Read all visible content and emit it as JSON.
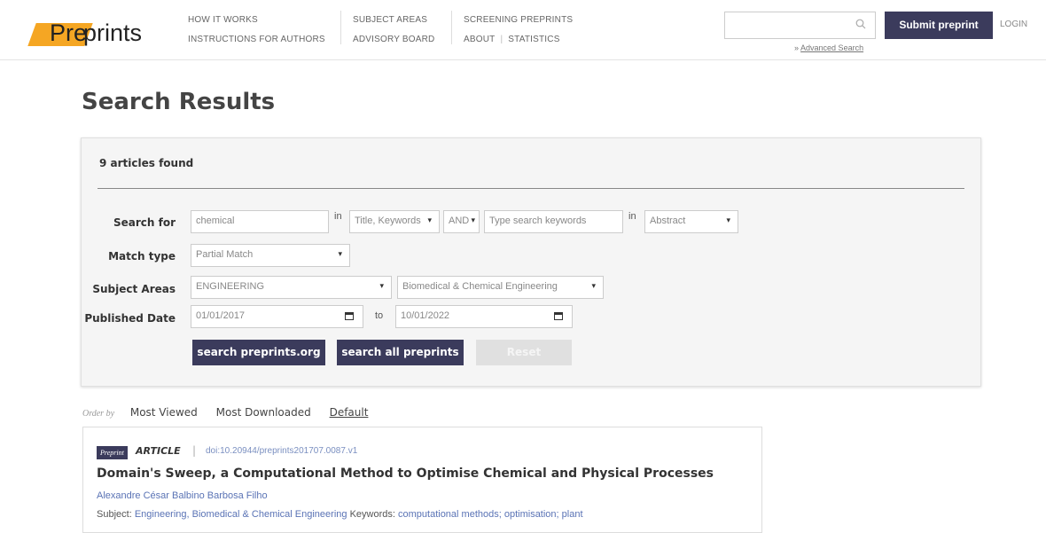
{
  "header": {
    "logo_pre": "Pre",
    "logo_prints": "prints",
    "nav": {
      "how_it_works": "HOW IT WORKS",
      "instructions": "INSTRUCTIONS FOR AUTHORS",
      "subject_areas": "SUBJECT AREAS",
      "advisory_board": "ADVISORY BOARD",
      "screening": "SCREENING PREPRINTS",
      "about": "ABOUT",
      "statistics": "STATISTICS"
    },
    "search_placeholder": "",
    "advanced_search_prefix": "»",
    "advanced_search": "Advanced Search",
    "submit_label": "Submit preprint",
    "login_label": "LOGIN"
  },
  "page": {
    "title": "Search Results"
  },
  "search": {
    "found": "9 articles found",
    "search_for_label": "Search for",
    "search_for_value": "chemical",
    "in_word": "in",
    "field1": "Title, Keywords",
    "operator": "AND",
    "keywords_placeholder": "Type search keywords",
    "field2": "Abstract",
    "match_type_label": "Match type",
    "match_type_value": "Partial Match",
    "subject_areas_label": "Subject Areas",
    "subject_area": "ENGINEERING",
    "subject_sub": "Biomedical & Chemical Engineering",
    "published_label": "Published Date",
    "date_from": "01/01/2017",
    "to_word": "to",
    "date_to": "10/01/2022",
    "btn_preprints": "search preprints.org",
    "btn_all": "search all preprints",
    "btn_reset": "Reset"
  },
  "order": {
    "label": "Order by",
    "options": [
      "Most Viewed",
      "Most Downloaded",
      "Default"
    ]
  },
  "results": [
    {
      "badge": "Preprint",
      "type": "ARTICLE",
      "doi": "doi:10.20944/preprints201707.0087.v1",
      "title": "Domain's Sweep, a Computational Method to Optimise Chemical and Physical Processes",
      "authors": "Alexandre César Balbino Barbosa Filho",
      "subject_prefix": "Subject:",
      "subject": "Engineering, Biomedical & Chemical Engineering",
      "keywords_prefix": "Keywords:",
      "keywords": "computational methods; optimisation; plant"
    }
  ],
  "colors": {
    "accent": "#3b3b5c",
    "logo": "#f5a623",
    "link": "#5a73b5"
  }
}
